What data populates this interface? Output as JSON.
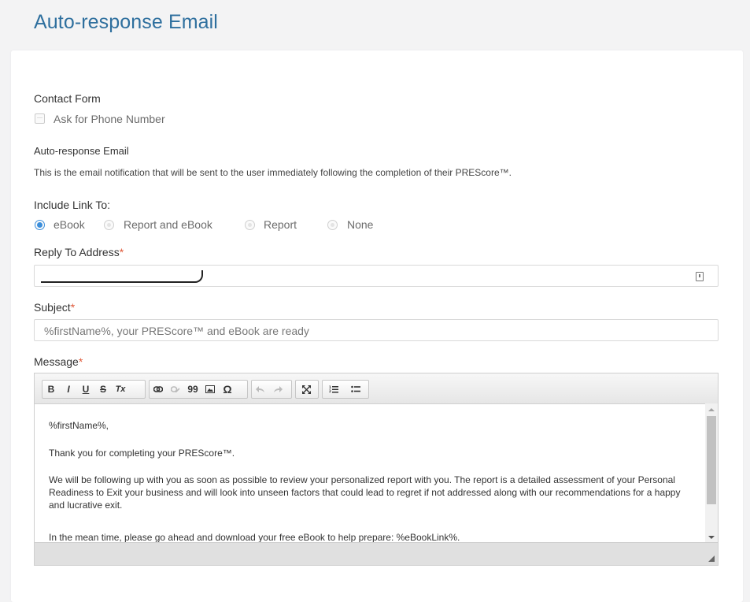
{
  "page": {
    "title": "Auto-response Email"
  },
  "contact_form": {
    "label": "Contact Form",
    "ask_phone": {
      "label": "Ask for Phone Number",
      "checked": false
    }
  },
  "auto_response": {
    "label": "Auto-response Email",
    "description": "This is the email notification that will be sent to the user immediately following the completion of their PREScore™."
  },
  "include_link": {
    "label": "Include Link To:",
    "options": [
      "eBook",
      "Report and eBook",
      "Report",
      "None"
    ],
    "selected": "eBook"
  },
  "reply_to": {
    "label": "Reply To Address",
    "required": "*",
    "value": ""
  },
  "subject": {
    "label": "Subject",
    "required": "*",
    "value": "%firstName%, your PREScore™ and eBook are ready"
  },
  "message": {
    "label": "Message",
    "required": "*",
    "toolbar": {
      "bold": "B",
      "italic": "I",
      "underline": "U",
      "strike": "S",
      "clear": "Tx",
      "quote": "99",
      "special": "Ω"
    },
    "paragraphs": [
      "%firstName%,",
      "Thank you for completing your PREScore™.",
      "We will be following up with you as soon as possible to review your personalized report with you. The report is a detailed assessment of your Personal Readiness to Exit your business and will look into unseen factors that could lead to regret if not addressed along with our recommendations for a happy and lucrative exit.",
      "In the mean time, please go ahead and download your free eBook to help prepare: %eBookLink%."
    ]
  },
  "colors": {
    "title": "#2e6f9e",
    "required": "#e05a3a",
    "radio_selected": "#3b8edb"
  }
}
